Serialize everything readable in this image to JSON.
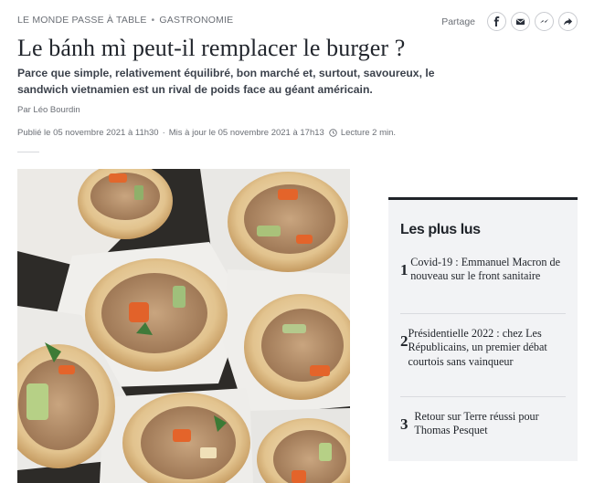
{
  "breadcrumb": {
    "section": "LE MONDE PASSE À TABLE",
    "separator": "•",
    "subsection": "GASTRONOMIE"
  },
  "share": {
    "label": "Partage",
    "icons": [
      "facebook-icon",
      "email-icon",
      "messenger-icon",
      "forward-icon"
    ]
  },
  "article": {
    "title": "Le bánh mì peut-il remplacer le burger ?",
    "description": "Parce que simple, relativement équilibré, bon marché et, surtout, savoureux, le sandwich vietnamien est un rival de poids face au géant américain.",
    "author": "Par Léo Bourdin",
    "published": "Publié le 05 novembre 2021 à 11h30",
    "meta_separator": "·",
    "updated": "Mis à jour le 05 novembre 2021 à 17h13",
    "reading_time": "Lecture 2 min."
  },
  "most_read": {
    "title": "Les plus lus",
    "items": [
      {
        "rank": "1",
        "text": "Covid-19 : Emmanuel Macron de nouveau sur le front sanitaire"
      },
      {
        "rank": "2",
        "text": "Présidentielle 2022 : chez Les Républicains, un premier débat courtois sans vainqueur"
      },
      {
        "rank": "3",
        "text": "Retour sur Terre réussi pour Thomas Pesquet"
      }
    ]
  }
}
